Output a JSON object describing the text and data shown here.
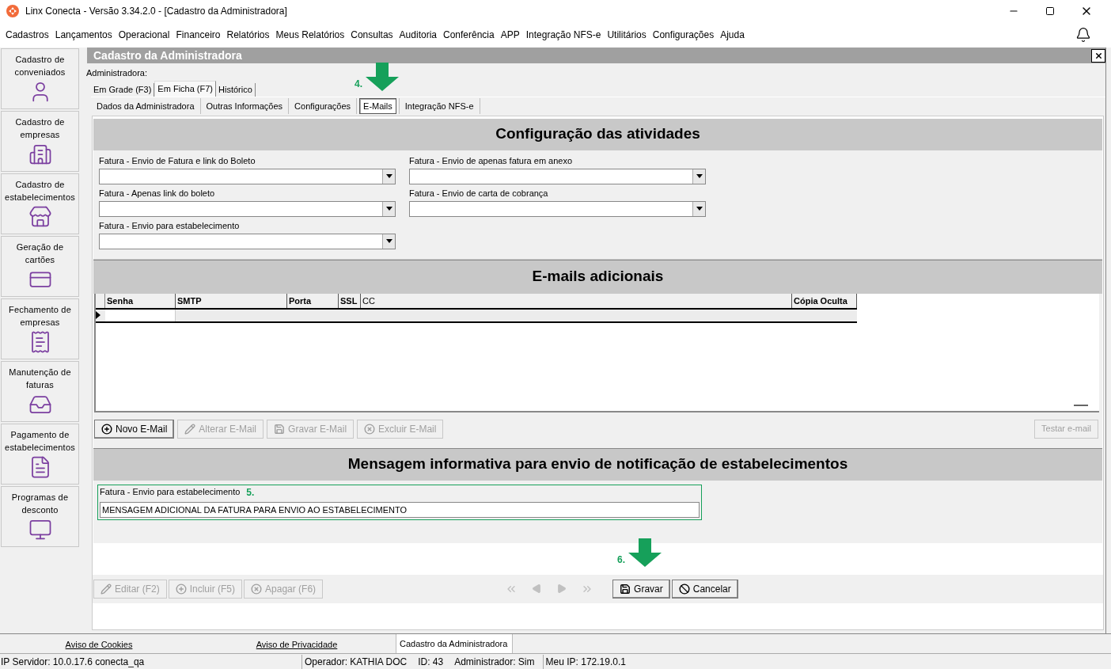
{
  "window": {
    "title": "Linx Conecta - Versão 3.34.2.0 - [Cadastro da Administradora]"
  },
  "menu": [
    "Cadastros",
    "Lançamentos",
    "Operacional",
    "Financeiro",
    "Relatórios",
    "Meus Relatórios",
    "Consultas",
    "Auditoria",
    "Conferência",
    "APP",
    "Integração NFS-e",
    "Utilitários",
    "Configurações",
    "Ajuda"
  ],
  "sidebar": {
    "items": [
      {
        "label": "Cadastro de conveniados"
      },
      {
        "label": "Cadastro de empresas"
      },
      {
        "label": "Cadastro de estabelecimentos"
      },
      {
        "label": "Geração de cartões"
      },
      {
        "label": "Fechamento de empresas"
      },
      {
        "label": "Manutenção de faturas"
      },
      {
        "label": "Pagamento de estabelecimentos"
      },
      {
        "label": "Programas de desconto"
      }
    ]
  },
  "form": {
    "title": "Cadastro da Administradora",
    "field_label": "Administradora:",
    "view_tabs": [
      {
        "label": "Em Grade (F3)",
        "selected": false
      },
      {
        "label": "Em Ficha (F7)",
        "selected": true
      },
      {
        "label": "Histórico",
        "selected": false
      }
    ],
    "page_tabs": [
      {
        "label": "Dados da Administradora",
        "selected": false
      },
      {
        "label": "Outras Informações",
        "selected": false
      },
      {
        "label": "Configurações",
        "selected": false
      },
      {
        "label": "E-Mails",
        "selected": true
      },
      {
        "label": "Integração NFS-e",
        "selected": false
      }
    ],
    "activities": {
      "heading": "Configuração das atividades",
      "dropdowns": [
        {
          "label": "Fatura - Envio de Fatura e link do Boleto"
        },
        {
          "label": "Fatura - Envio de apenas fatura em anexo"
        },
        {
          "label": "Fatura - Apenas link do boleto"
        },
        {
          "label": "Fatura - Envio de carta de cobrança"
        },
        {
          "label": "Fatura - Envio para estabelecimento"
        }
      ]
    },
    "emails": {
      "heading": "E-mails adicionais",
      "columns": [
        {
          "label": "Senha",
          "bold": true
        },
        {
          "label": "SMTP",
          "bold": true
        },
        {
          "label": "Porta",
          "bold": true
        },
        {
          "label": "SSL",
          "bold": true
        },
        {
          "label": "CC",
          "bold": false
        },
        {
          "label": "Cópia Oculta",
          "bold": true
        }
      ],
      "buttons": [
        {
          "label": "Novo E-Mail",
          "disabled": false
        },
        {
          "label": "Alterar E-Mail",
          "disabled": true
        },
        {
          "label": "Gravar E-Mail",
          "disabled": true
        },
        {
          "label": "Excluir E-Mail",
          "disabled": true
        }
      ],
      "test_button": {
        "label": "Testar e-mail",
        "disabled": true
      }
    },
    "message": {
      "heading": "Mensagem informativa para envio de notificação de estabelecimentos",
      "field_label": "Fatura - Envio para estabelecimento",
      "value": "MENSAGEM ADICIONAL DA FATURA PARA ENVIO AO ESTABELECIMENTO"
    },
    "toolbar": [
      {
        "label": "Editar (F2)",
        "disabled": true
      },
      {
        "label": "Incluir (F5)",
        "disabled": true
      },
      {
        "label": "Apagar (F6)",
        "disabled": true
      }
    ],
    "actions": [
      {
        "label": "Gravar",
        "disabled": false
      },
      {
        "label": "Cancelar",
        "disabled": false
      }
    ]
  },
  "annotations": [
    "4.",
    "5.",
    "6."
  ],
  "footer_tabs": [
    {
      "label": "Aviso de Cookies",
      "kind": "link"
    },
    {
      "label": "Aviso de Privacidade",
      "kind": "link"
    },
    {
      "label": "Cadastro da Administradora",
      "kind": "tab"
    }
  ],
  "status_bar": [
    "IP Servidor: 10.0.17.6 conecta_qa",
    "Operador: KATHIA DOC",
    "ID: 43",
    "Administrador: Sim",
    "Meu IP: 172.19.0.1"
  ]
}
